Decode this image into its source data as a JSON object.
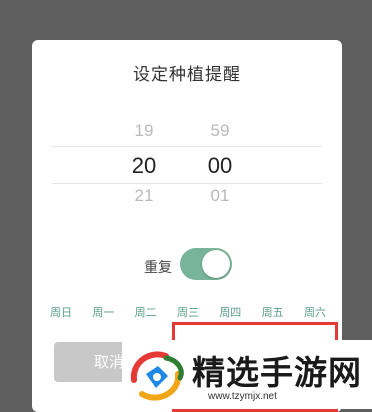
{
  "dialog": {
    "title": "设定种植提醒",
    "hours": {
      "prev": "19",
      "selected": "20",
      "next": "21"
    },
    "minutes": {
      "prev": "59",
      "selected": "00",
      "next": "01"
    },
    "repeat_label": "重复",
    "repeat_enabled": true,
    "weekdays": [
      "周日",
      "周一",
      "周二",
      "周三",
      "周四",
      "周五",
      "周六"
    ],
    "cancel_label": "取消"
  },
  "watermark": {
    "text": "精选手游网",
    "url": "www.tzymjx.net"
  },
  "colors": {
    "accent": "#78b49a",
    "weekday_text": "#5a9e86",
    "highlight_box": "#e53935"
  }
}
